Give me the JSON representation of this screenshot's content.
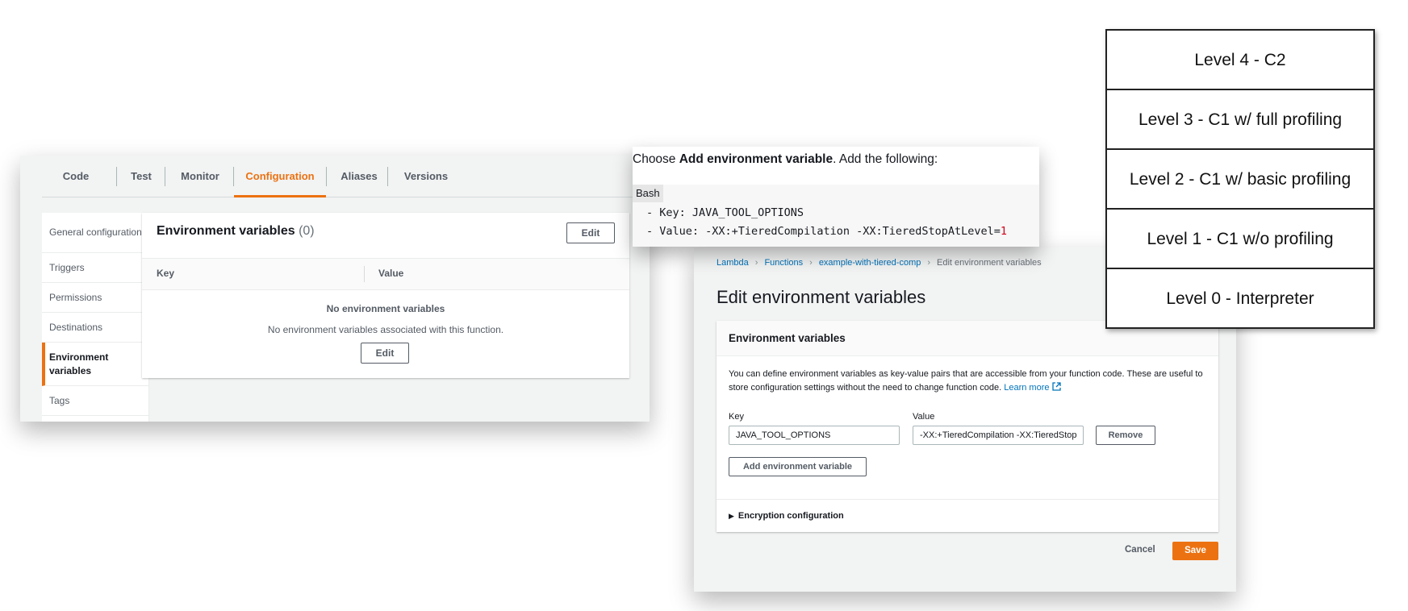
{
  "config_panel": {
    "tabs": [
      "Code",
      "Test",
      "Monitor",
      "Configuration",
      "Aliases",
      "Versions"
    ],
    "active_tab": "Configuration",
    "sidebar": [
      "General configuration",
      "Triggers",
      "Permissions",
      "Destinations",
      "Environment variables",
      "Tags"
    ],
    "active_sidebar": "Environment variables",
    "env_title": "Environment variables",
    "env_count": "(0)",
    "edit_label": "Edit",
    "col_key": "Key",
    "col_value": "Value",
    "empty_title": "No environment variables",
    "empty_sub": "No environment variables associated with this function.",
    "empty_edit_label": "Edit"
  },
  "doc_snippet": {
    "intro_prefix": "Choose ",
    "intro_bold": "Add environment variable",
    "intro_suffix": ". Add the following:",
    "language": "Bash",
    "line1": "- Key: JAVA_TOOL_OPTIONS",
    "line2_text": "- Value: -XX:+TieredCompilation -XX:TieredStopAtLevel=",
    "line2_num": "1"
  },
  "edit_panel": {
    "breadcrumbs": [
      "Lambda",
      "Functions",
      "example-with-tiered-comp",
      "Edit environment variables"
    ],
    "heading": "Edit environment variables",
    "card_title": "Environment variables",
    "description": "You can define environment variables as key-value pairs that are accessible from your function code. These are useful to store configuration settings without the need to change function code.",
    "learn_more": "Learn more",
    "key_label": "Key",
    "value_label": "Value",
    "key_value": "JAVA_TOOL_OPTIONS",
    "value_value": "-XX:+TieredCompilation -XX:TieredStop",
    "remove_label": "Remove",
    "add_label": "Add environment variable",
    "encryption_label": "Encryption configuration",
    "cancel_label": "Cancel",
    "save_label": "Save",
    "accent": "#ec7211",
    "link_color": "#0073bb"
  },
  "levels_diagram": {
    "levels": [
      "Level 4 - C2",
      "Level 3 - C1 w/ full profiling",
      "Level 2 - C1 w/ basic profiling",
      "Level 1 - C1 w/o profiling",
      "Level 0 - Interpreter"
    ]
  }
}
